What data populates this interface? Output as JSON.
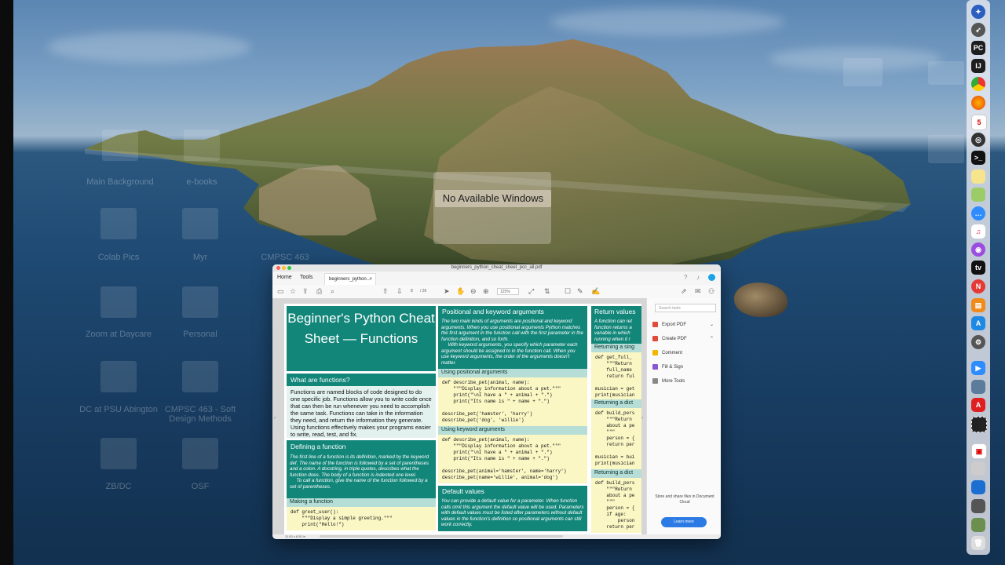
{
  "overlay": {
    "no_windows_label": "No Available Windows"
  },
  "desktop_ghost_labels": [
    "Main Background",
    "e-books",
    "Colab Pics",
    "Myr",
    "CMPSC 463",
    "Zoom at Daycare",
    "Personal",
    "DC at PSU Abington",
    "CMPSC 463 - Soft Design Methods",
    "ZB/DC",
    "OSF"
  ],
  "acrobat": {
    "filename": "beginners_python_cheat_sheet_pcc_all.pdf",
    "tabs": {
      "home": "Home",
      "tools": "Tools",
      "document": "beginners_python..."
    },
    "toolbar": {
      "page": "8",
      "page_total": "/ 26",
      "zoom": "125%"
    },
    "status": "11.00 x 8.50 in",
    "right_pane": {
      "search_placeholder": "Search tools",
      "items": [
        "Export PDF",
        "Create PDF",
        "Comment",
        "Fill & Sign",
        "More Tools"
      ],
      "promo_text": "Store and share files in Document Cloud",
      "learn_more": "Learn more"
    },
    "cheat_sheet": {
      "title": "Beginner's Python Cheat Sheet — Functions",
      "what_heading": "What are functions?",
      "what_body": "Functions are named blocks of code designed to do one specific job. Functions allow you to write code once that can then be run whenever you need to accomplish the same task. Functions can take in the information they need, and return the information they generate. Using functions effectively makes your programs easier to write, read, test, and fix.",
      "defining_heading": "Defining a function",
      "defining_body": "The first line of a function is its definition, marked by the keyword def. The name of the function is followed by a set of parentheses and a colon. A docstring, in triple quotes, describes what the function does. The body of a function is indented one level.\n     To call a function, give the name of the function followed by a set of parentheses.",
      "making_label": "Making a function",
      "making_code": "def greet_user():\n    \"\"\"Display a simple greeting.\"\"\"\n    print(\"Hello!\")",
      "positional_heading": "Positional and keyword arguments",
      "positional_body": "The two main kinds of arguments are positional and keyword arguments. When you use positional arguments Python matches the first argument in the function call with the first parameter in the function definition, and so forth.\n     With keyword arguments, you specify which parameter each argument should be assigned to in the function call. When you use keyword arguments, the order of the arguments doesn't matter.",
      "using_positional_label": "Using positional arguments",
      "using_positional_code": "def describe_pet(animal, name):\n    \"\"\"Display information about a pet.\"\"\"\n    print(\"\\nI have a \" + animal + \".\")\n    print(\"Its name is \" + name + \".\")\n\ndescribe_pet('hamster', 'harry')\ndescribe_pet('dog', 'willie')",
      "using_keyword_label": "Using keyword arguments",
      "using_keyword_code": "def describe_pet(animal, name):\n    \"\"\"Display information about a pet.\"\"\"\n    print(\"\\nI have a \" + animal + \".\")\n    print(\"Its name is \" + name + \".\")\n\ndescribe_pet(animal='hamster', name='harry')\ndescribe_pet(name='willie', animal='dog')",
      "default_heading": "Default values",
      "default_body": "You can provide a default value for a parameter. When function calls omit this argument the default value will be used. Parameters with default values must be listed after parameters without default values in the function's definition so positional arguments can still work correctly.",
      "return_heading": "Return values",
      "return_body": "A function can ret function returns a variable in which running when it r",
      "returning_single_label": "Returning a sing",
      "returning_single_code": "def get_full_\n    \"\"\"Return\n    full_name\n    return ful\n\nmusician = get\nprint(musician",
      "returning_dict_label": "Returning a dict",
      "returning_dict_code": "def build_pers\n    \"\"\"Return\n    about a pe\n    \"\"\"\n    person = {\n    return per\n\nmusician = bui\nprint(musician",
      "returning_dict2_label": "Returning a dict",
      "returning_dict2_code": "def build_pers\n    \"\"\"Return\n    about a pe\n    \"\"\"\n    person = {\n    if age:\n        person\n    return per"
    }
  },
  "colors": {
    "teal": "#13867a",
    "subhead": "#b7ddd7",
    "code_bg": "#fbf7c5",
    "learn_more_btn": "#2c7be5"
  }
}
